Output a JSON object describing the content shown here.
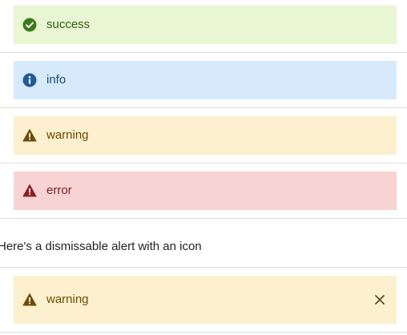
{
  "alerts": {
    "success": {
      "label": "success",
      "icon": "check-circle-icon",
      "bg": "#e8f6d3",
      "fg": "#3b5a12",
      "icon_color": "#3d7a1e"
    },
    "info": {
      "label": "info",
      "icon": "info-circle-icon",
      "bg": "#d6eafb",
      "fg": "#174b78",
      "icon_color": "#1f5c93"
    },
    "warning": {
      "label": "warning",
      "icon": "warning-triangle-icon",
      "bg": "#fdf0cf",
      "fg": "#6a4b00",
      "icon_color": "#6b4c06"
    },
    "error": {
      "label": "error",
      "icon": "error-triangle-icon",
      "bg": "#f7d3d3",
      "fg": "#7a1f1f",
      "icon_color": "#8c1d1d"
    }
  },
  "dismissable": {
    "description": "Here's a dismissable alert with an icon",
    "alert": {
      "label": "warning",
      "icon": "warning-triangle-icon",
      "close_icon": "close-icon",
      "bg": "#fdf0cf",
      "fg": "#6a4b00"
    }
  }
}
